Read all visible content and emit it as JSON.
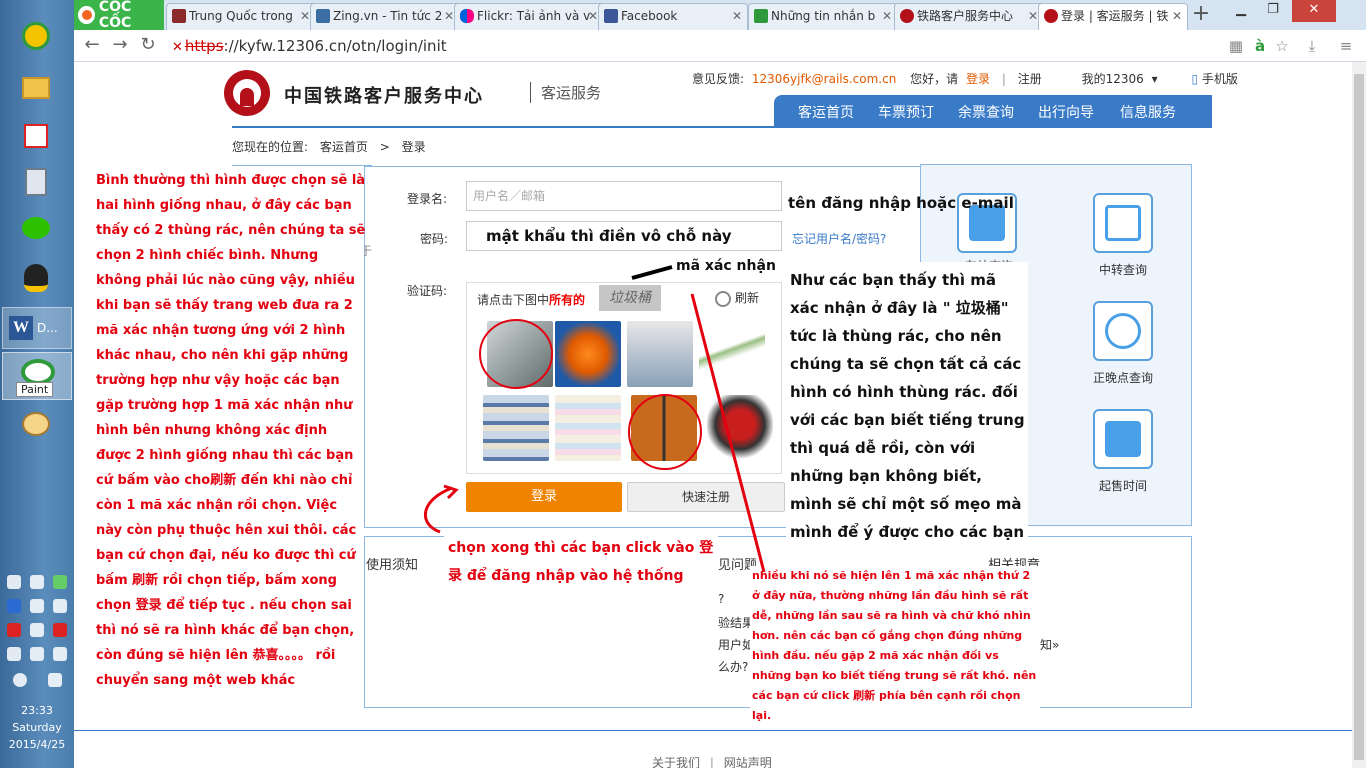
{
  "taskbar": {
    "word_label": "D...",
    "paint_tooltip": "Paint",
    "clock_time": "23:33",
    "clock_day": "Saturday",
    "clock_date": "2015/4/25"
  },
  "browser": {
    "brand": "CỐC CỐC",
    "tabs": [
      {
        "label": "Trung Quốc trong"
      },
      {
        "label": "Zing.vn - Tin tức 2"
      },
      {
        "label": "Flickr: Tải ảnh và v"
      },
      {
        "label": "Facebook"
      },
      {
        "label": "Những tin nhắn b"
      },
      {
        "label": "铁路客户服务中心"
      },
      {
        "label": "登录 | 客运服务 | 铁"
      }
    ],
    "address_scheme": "https",
    "address_rest": "://kyfw.12306.cn/otn/login/init"
  },
  "site": {
    "title": "中国铁路客户服务中心",
    "subtitle": "客运服务",
    "top_links": {
      "feedback_label": "意见反馈:",
      "feedback_email": "12306yjfk@rails.com.cn",
      "hello": "您好，请",
      "login": "登录",
      "register": "注册",
      "my12306": "我的12306",
      "mobile": "手机版"
    },
    "nav": [
      "客运首页",
      "车票预订",
      "余票查询",
      "出行向导",
      "信息服务"
    ],
    "breadcrumb": {
      "prefix": "您现在的位置:",
      "home": "客运首页",
      "sep": ">",
      "current": "登录"
    }
  },
  "login": {
    "username_label": "登录名:",
    "username_placeholder": "用户名／邮箱",
    "password_label": "密码:",
    "forgot": "忘记用户名/密码?",
    "captcha_label": "验证码:",
    "captcha_prompt_a": "请点击下图中",
    "captcha_prompt_b": "所有的",
    "captcha_word": "垃圾桶",
    "refresh": "刷新",
    "login_button": "登录",
    "register_button": "快速注册"
  },
  "sidebar": {
    "items": [
      {
        "label": "中转查询"
      },
      {
        "label": "正晚点查询"
      },
      {
        "label": "起售时间"
      }
    ],
    "partial_label": "车站查询"
  },
  "lower": {
    "notice": "使用须知",
    "faq": "见问题",
    "related": "相关规章",
    "q1": "?",
    "q2": "验结果",
    "q3": "用户如",
    "q4": "么办?",
    "more": "知»",
    "edge_char": "于"
  },
  "footer": {
    "about": "关于我们",
    "sep": "|",
    "statement": "网站声明"
  },
  "annotations": {
    "left_note": "Bình thường thì hình được chọn sẽ là hai hình giống nhau,  ở đây các bạn thấy có 2 thùng rác, nên chúng ta sẽ chọn 2 hình chiếc bình. Nhưng không phải lúc nào cũng vậy, nhiều khi bạn sẽ thấy trang web đưa ra 2 mã xác nhận tương ứng với 2 hình khác nhau, cho nên khi gặp những trường hợp như vậy hoặc các bạn gặp trường hợp 1 mã xác nhận như hình bên nhưng không xác định được 2 hình giống nhau thì các bạn cứ bấm vào cho刷新 đến khi nào chỉ còn 1 mã xác nhận rồi chọn. Việc này còn phụ thuộc hên xui thôi. các bạn cứ chọn đại, nếu ko được thì cứ bấm  刷新 rồi chọn tiếp, bấm xong chọn 登录 để tiếp tục . nếu chọn sai thì nó sẽ ra hình khác để bạn chọn, còn đúng sẽ hiện lên 恭喜。。。。 rồi chuyển sang một web khác",
    "username_hint": "tên đăng nhập hoặc e-mail",
    "password_hint": "mật khẩu thì điền vô chỗ này",
    "captcha_hint": "mã xác nhận",
    "right_note": "Như các bạn thấy thì mã xác nhận ở đây là \" 垃圾桶\"   tức là thùng rác, cho nên chúng ta sẽ chọn tất cả các hình có hình thùng rác. đối với các bạn biết tiếng trung thì quá dễ rồi, còn với những bạn không biết, mình sẽ chỉ một số mẹo mà mình để ý được cho các bạn",
    "click_note": "chọn xong thì các bạn click vào 登录 để đăng nhập vào hệ thống",
    "bottom_note": "nhiều khi nó sẽ hiện lên 1 mã xác nhận thứ 2 ở đây nữa, thường những lần đầu hình sẽ rất dễ, những lần sau sẽ ra hình và chữ khó nhìn hơn. nên các bạn cố gắng chọn đúng những hình đầu. nếu gặp 2 mã xác nhận đối vs những bạn ko biết tiếng trung sẽ rất khó. nên các bạn cứ click 刷新 phía bên cạnh rồi chọn lại."
  },
  "colors": {
    "accent": "#3a7bc8",
    "login_button": "#f08300",
    "annotation": "#e3000f",
    "brand_red": "#b3101a"
  }
}
